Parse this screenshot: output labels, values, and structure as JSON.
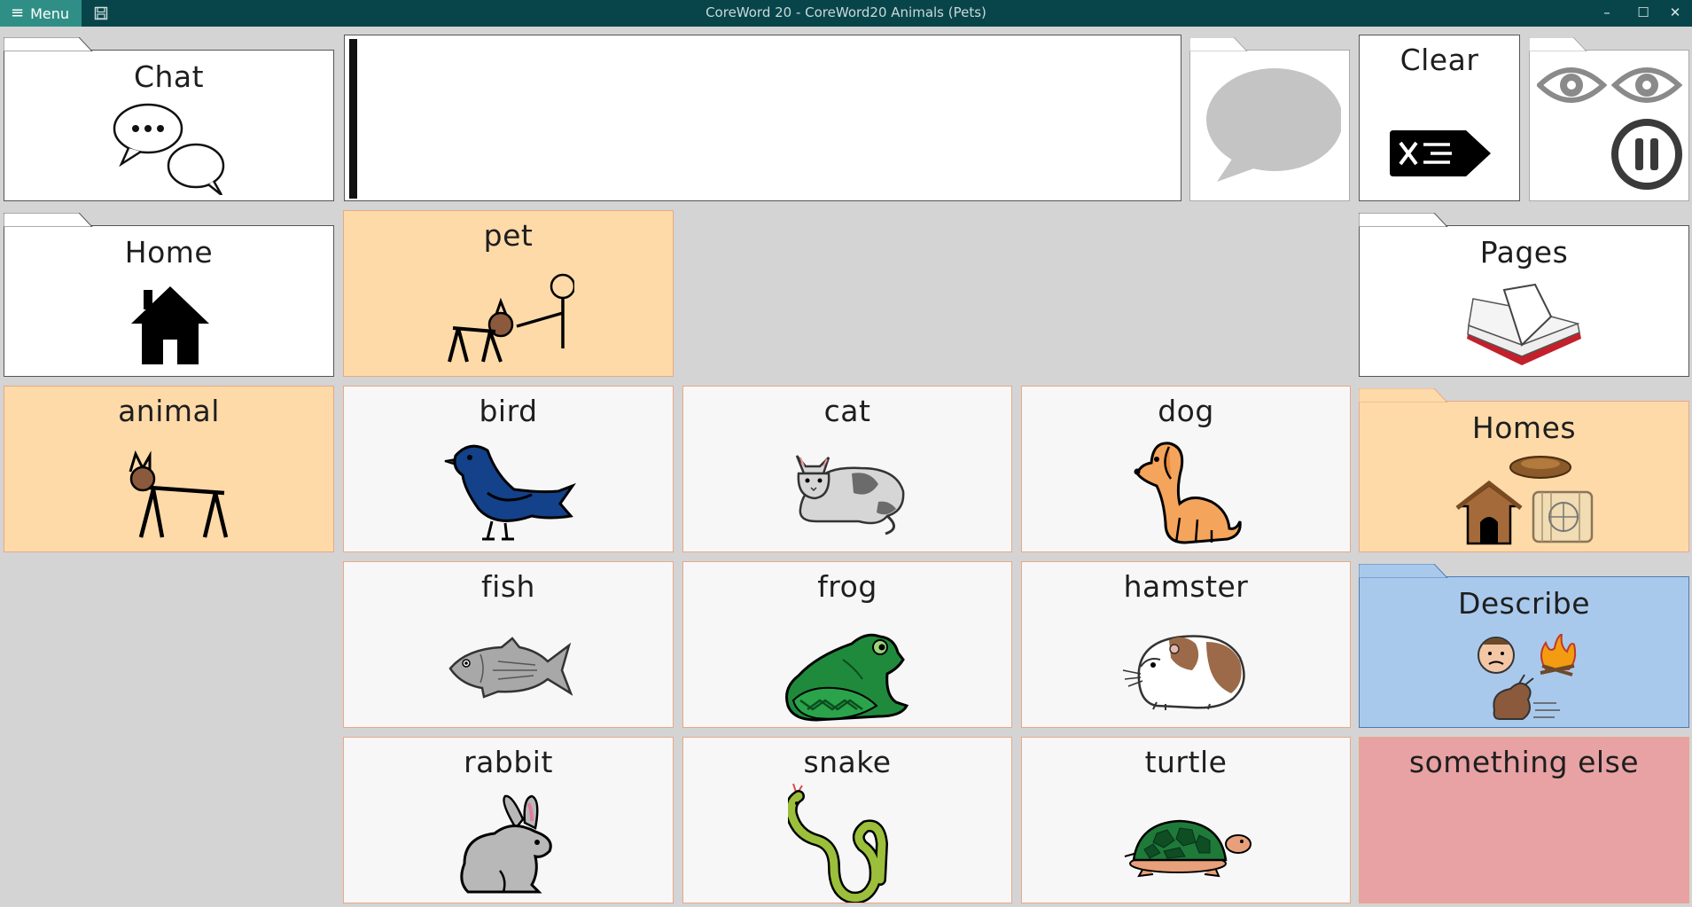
{
  "titlebar": {
    "menu_label": "Menu",
    "title": "CoreWord 20 - CoreWord20 Animals (Pets)",
    "minimize": "–",
    "maximize": "☐",
    "close": "✕"
  },
  "top": {
    "chat_label": "Chat",
    "clear_label": "Clear",
    "message_text": ""
  },
  "cells": {
    "home": "Home",
    "pet": "pet",
    "pages": "Pages",
    "animal": "animal",
    "bird": "bird",
    "cat": "cat",
    "dog": "dog",
    "homes": "Homes",
    "fish": "fish",
    "frog": "frog",
    "hamster": "hamster",
    "describe": "Describe",
    "rabbit": "rabbit",
    "snake": "snake",
    "turtle": "turtle",
    "something_else": "something else"
  },
  "colors": {
    "titlebar": "#08454a",
    "menu_button": "#2f8f86",
    "noun_peach": "#fddaa8",
    "describe_blue": "#a9c9ec",
    "something_else_red": "#e8a2a4"
  }
}
